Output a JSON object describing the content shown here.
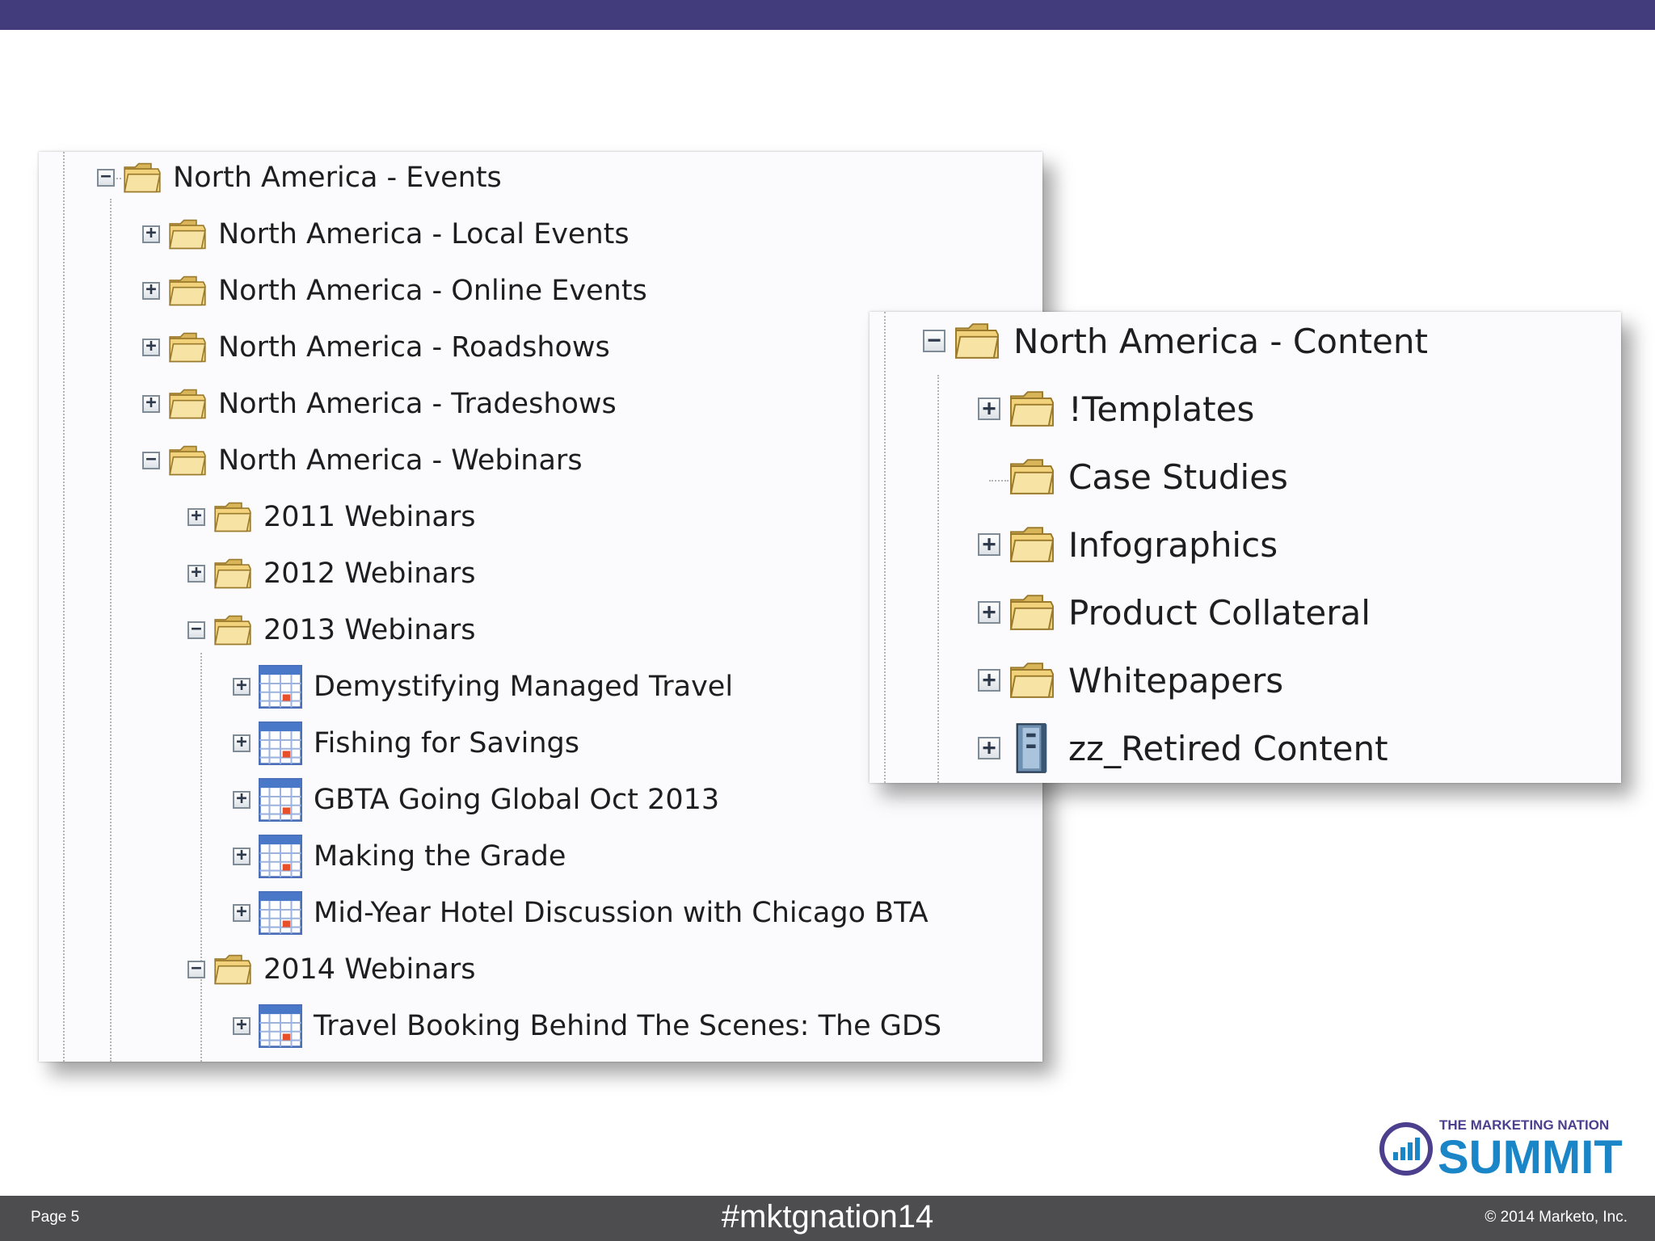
{
  "events_tree": {
    "root": {
      "label": "North America - Events",
      "expanded": true
    },
    "items": [
      {
        "label": "North America - Local Events",
        "level": 1,
        "icon": "folder-icon",
        "toggle": "+"
      },
      {
        "label": "North America - Online Events",
        "level": 1,
        "icon": "folder-icon",
        "toggle": "+"
      },
      {
        "label": "North America - Roadshows",
        "level": 1,
        "icon": "folder-icon",
        "toggle": "+"
      },
      {
        "label": "North America - Tradeshows",
        "level": 1,
        "icon": "folder-icon",
        "toggle": "+"
      },
      {
        "label": "North America - Webinars",
        "level": 1,
        "icon": "folder-icon",
        "toggle": "-"
      },
      {
        "label": "2011 Webinars",
        "level": 2,
        "icon": "folder-icon",
        "toggle": "+"
      },
      {
        "label": "2012 Webinars",
        "level": 2,
        "icon": "folder-icon",
        "toggle": "+"
      },
      {
        "label": "2013 Webinars",
        "level": 2,
        "icon": "folder-icon",
        "toggle": "-"
      },
      {
        "label": "Demystifying Managed Travel",
        "level": 3,
        "icon": "calendar-icon",
        "toggle": "+"
      },
      {
        "label": "Fishing for Savings",
        "level": 3,
        "icon": "calendar-icon",
        "toggle": "+"
      },
      {
        "label": "GBTA Going Global Oct 2013",
        "level": 3,
        "icon": "calendar-icon",
        "toggle": "+"
      },
      {
        "label": "Making the Grade",
        "level": 3,
        "icon": "calendar-icon",
        "toggle": "+"
      },
      {
        "label": "Mid-Year Hotel Discussion with Chicago BTA",
        "level": 3,
        "icon": "calendar-icon",
        "toggle": "+"
      },
      {
        "label": "2014 Webinars",
        "level": 2,
        "icon": "folder-icon",
        "toggle": "-"
      },
      {
        "label": "Travel Booking Behind The Scenes: The GDS",
        "level": 3,
        "icon": "calendar-icon",
        "toggle": "+"
      }
    ]
  },
  "content_tree": {
    "root": {
      "label": "North America - Content",
      "expanded": true
    },
    "items": [
      {
        "label": "!Templates",
        "icon": "folder-icon",
        "toggle": "+"
      },
      {
        "label": "Case Studies",
        "icon": "folder-icon",
        "toggle": ""
      },
      {
        "label": "Infographics",
        "icon": "folder-icon",
        "toggle": "+"
      },
      {
        "label": "Product Collateral",
        "icon": "folder-icon",
        "toggle": "+"
      },
      {
        "label": "Whitepapers",
        "icon": "folder-icon",
        "toggle": "+"
      },
      {
        "label": "zz_Retired Content",
        "icon": "archive-icon",
        "toggle": "+"
      }
    ]
  },
  "footer": {
    "page": "Page 5",
    "hashtag": "#mktgnation14",
    "copyright": "© 2014 Marketo, Inc."
  },
  "logo": {
    "tagline": "THE MARKETING NATION",
    "name": "SUMMIT"
  },
  "colors": {
    "top_bar": "#433c7c",
    "footer_bar": "#4d4d4f",
    "logo_blue": "#1a86c8",
    "logo_purple": "#4b3f8e",
    "folder": "#f2d27a"
  }
}
